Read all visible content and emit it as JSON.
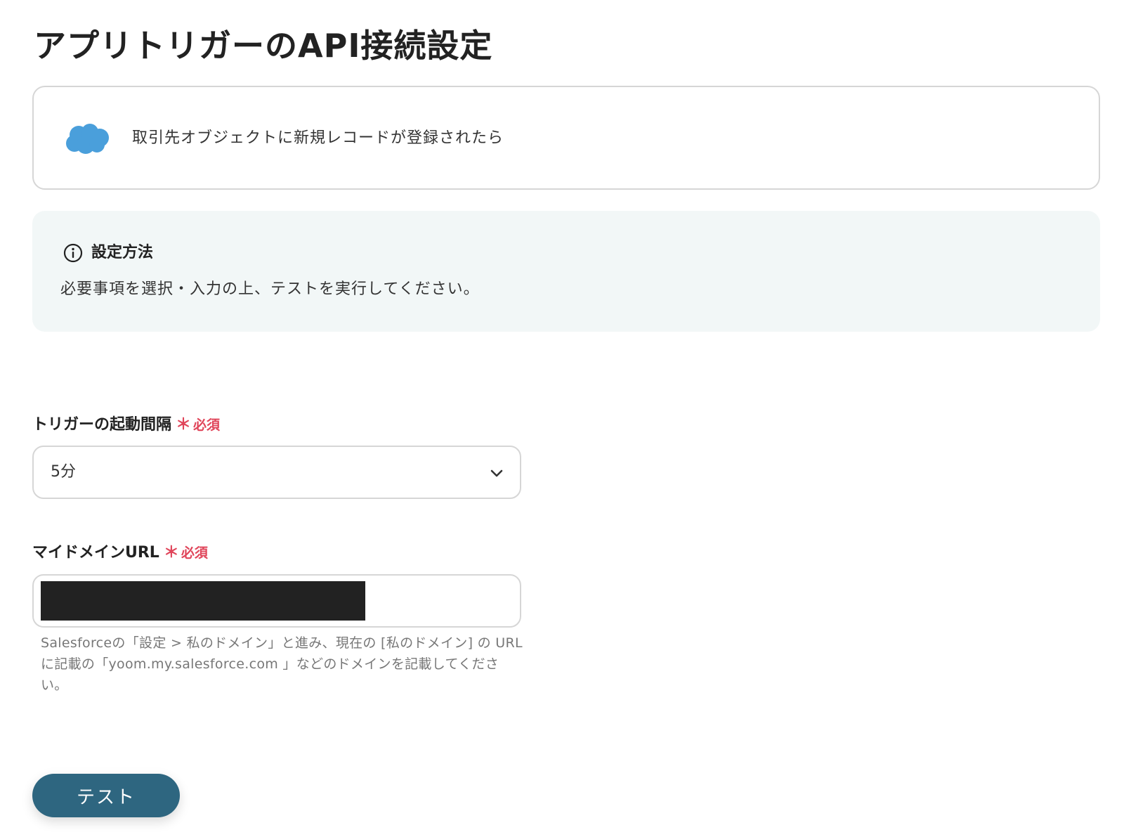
{
  "page": {
    "title": "アプリトリガーのAPI接続設定"
  },
  "trigger": {
    "app_icon": "salesforce-cloud-icon",
    "app_color": "#4a9fdb",
    "label": "取引先オブジェクトに新規レコードが登録されたら"
  },
  "info": {
    "icon": "info-icon",
    "title": "設定方法",
    "body": "必要事項を選択・入力の上、テストを実行してください。"
  },
  "fields": {
    "interval": {
      "label": "トリガーの起動間隔",
      "required_mark": "＊",
      "required_text": "必須",
      "value": "5分"
    },
    "domain_url": {
      "label": "マイドメインURL",
      "required_mark": "＊",
      "required_text": "必須",
      "value_redacted": true,
      "help": "Salesforceの「設定 > 私のドメイン」と進み、現在の [私のドメイン] の URLに記載の「yoom.my.salesforce.com 」などのドメインを記載してください。"
    }
  },
  "actions": {
    "test_label": "テスト"
  },
  "colors": {
    "accent": "#2e6680",
    "required": "#e0455a",
    "info_bg": "#f2f7f7",
    "border": "#d6d6d6"
  }
}
